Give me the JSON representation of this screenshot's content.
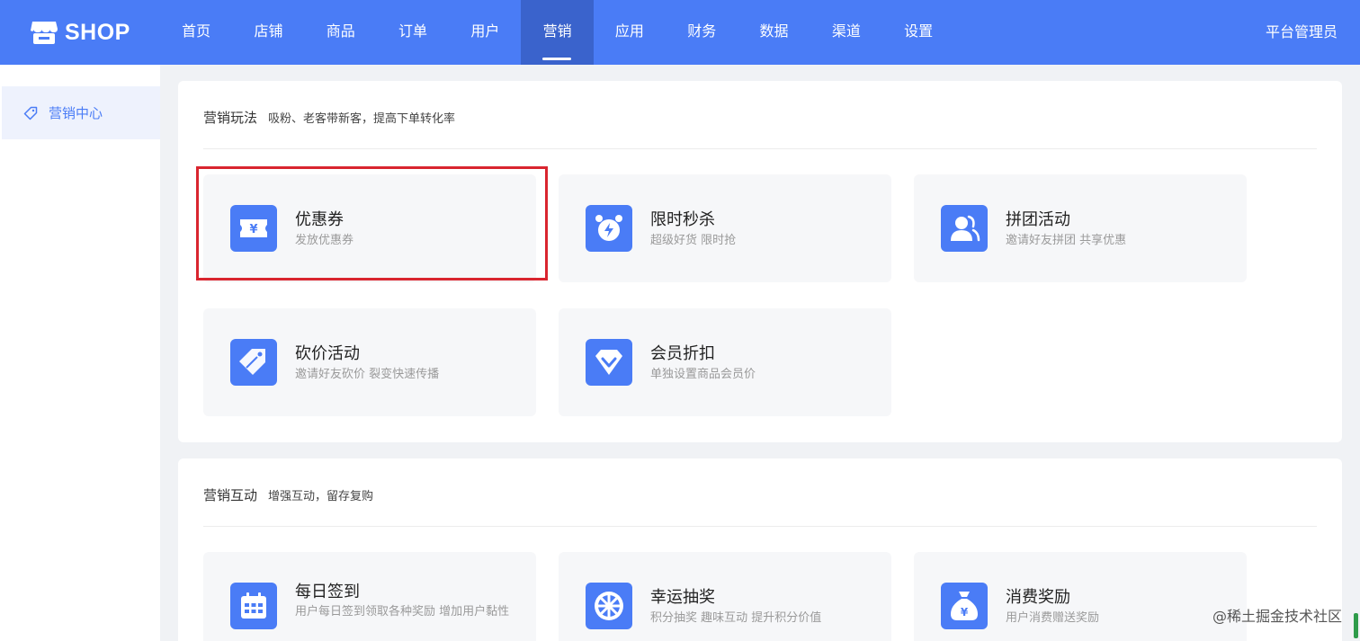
{
  "brand": {
    "name": "SHOP",
    "color": "#4a7cf6"
  },
  "nav": {
    "items": [
      "首页",
      "店铺",
      "商品",
      "订单",
      "用户",
      "营销",
      "应用",
      "财务",
      "数据",
      "渠道",
      "设置"
    ],
    "active": "营销"
  },
  "user": {
    "label": "平台管理员"
  },
  "sidebar": {
    "items": [
      {
        "label": "营销中心",
        "icon": "tag-icon",
        "active": true
      }
    ]
  },
  "sections": [
    {
      "title": "营销玩法",
      "subtitle": "吸粉、老客带新客，提高下单转化率",
      "items": [
        {
          "title": "优惠券",
          "desc": "发放优惠券",
          "icon": "coupon-icon",
          "highlighted": true
        },
        {
          "title": "限时秒杀",
          "desc": "超级好货 限时抢",
          "icon": "alarm-clock-icon"
        },
        {
          "title": "拼团活动",
          "desc": "邀请好友拼团 共享优惠",
          "icon": "group-users-icon"
        },
        {
          "title": "砍价活动",
          "desc": "邀请好友砍价 裂变快速传播",
          "icon": "price-tag-icon"
        },
        {
          "title": "会员折扣",
          "desc": "单独设置商品会员价",
          "icon": "diamond-icon"
        }
      ]
    },
    {
      "title": "营销互动",
      "subtitle": "增强互动，留存复购",
      "items": [
        {
          "title": "每日签到",
          "desc": "用户每日签到领取各种奖励 增加用户黏性",
          "icon": "calendar-icon"
        },
        {
          "title": "幸运抽奖",
          "desc": "积分抽奖 趣味互动 提升积分价值",
          "icon": "prize-wheel-icon"
        },
        {
          "title": "消费奖励",
          "desc": "用户消费赠送奖励",
          "icon": "money-bag-icon"
        }
      ]
    }
  ],
  "watermark": "@稀土掘金技术社区",
  "highlight_color": "#d9252f"
}
